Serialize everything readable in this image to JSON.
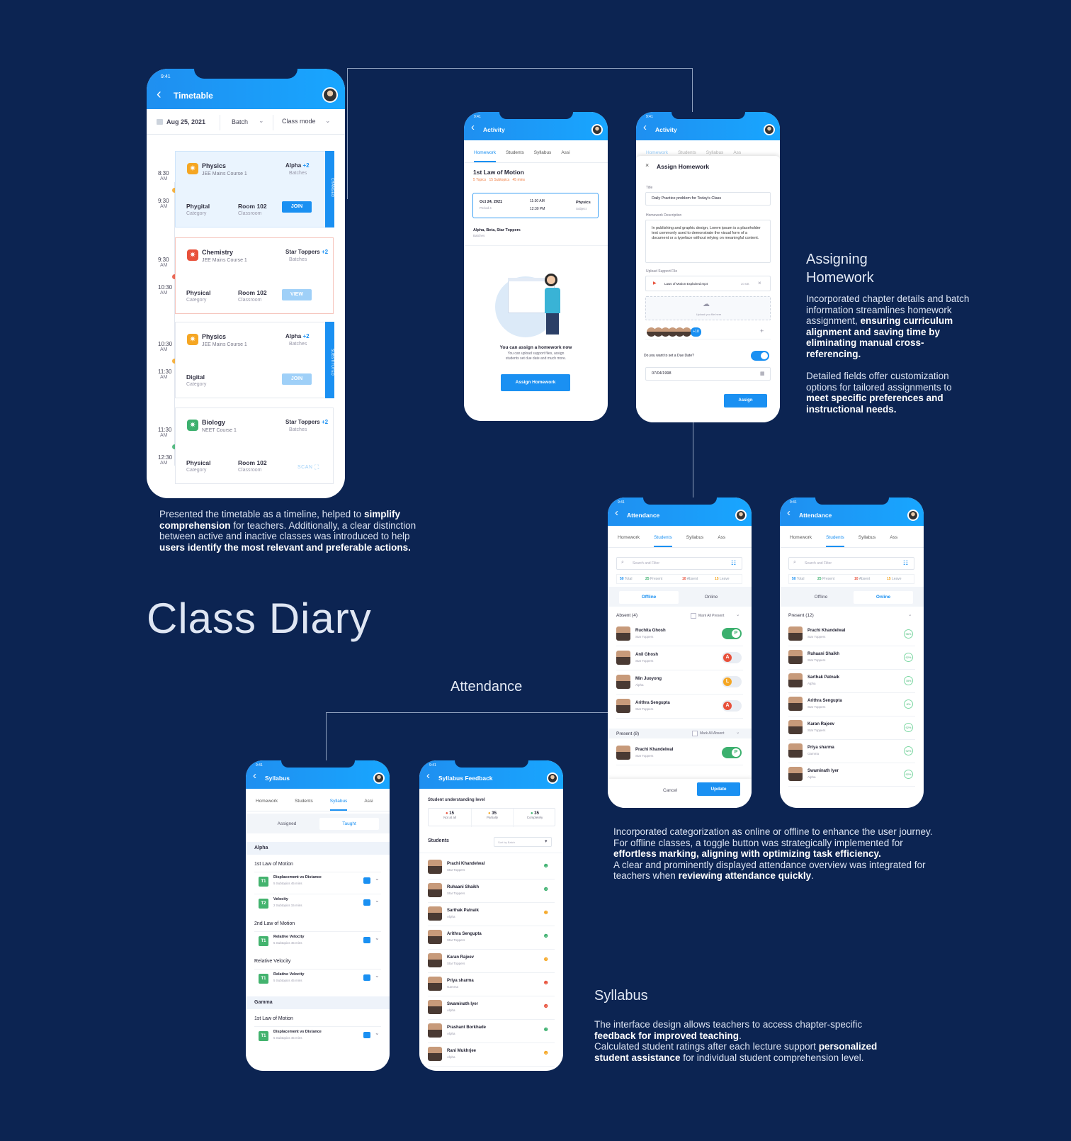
{
  "main_title": "Class Diary",
  "timetable": {
    "time": "9:41",
    "title": "Timetable",
    "date": "Aug 25, 2021",
    "batch": "Batch",
    "class_mode": "Class mode",
    "classes": [
      {
        "start": "8:30",
        "start_ampm": "AM",
        "end": "9:30",
        "end_ampm": "AM",
        "subject": "Physics",
        "course": "JEE Mains Course 1",
        "batch": "Alpha",
        "more": "+2",
        "batch_label": "Batches",
        "mode": "Phygital",
        "mode_label": "Category",
        "room": "Room 102",
        "room_label": "Classroom",
        "action": "JOIN",
        "tag": "CHANGED"
      },
      {
        "start": "9:30",
        "start_ampm": "AM",
        "end": "10:30",
        "end_ampm": "AM",
        "subject": "Chemistry",
        "course": "JEE Mains Course 1",
        "batch": "Star Toppers",
        "more": "+2",
        "batch_label": "Batches",
        "mode": "Physical",
        "mode_label": "Category",
        "room": "Room 102",
        "room_label": "Classroom",
        "action": "VIEW"
      },
      {
        "start": "10:30",
        "start_ampm": "AM",
        "end": "11:30",
        "end_ampm": "AM",
        "subject": "Physics",
        "course": "JEE Mains Course 1",
        "batch": "Alpha",
        "more": "+2",
        "batch_label": "Batches",
        "mode": "Digital",
        "mode_label": "Category",
        "action": "JOIN",
        "tag": "SUBSTITUTED"
      },
      {
        "start": "11:30",
        "start_ampm": "AM",
        "end": "12:30",
        "end_ampm": "AM",
        "subject": "Biology",
        "course": "NEET Course 1",
        "batch": "Star Toppers",
        "more": "+2",
        "batch_label": "Batches",
        "mode": "Physical",
        "mode_label": "Category",
        "room": "Room 102",
        "room_label": "Classroom",
        "action": "SCAN"
      }
    ]
  },
  "timetable_desc": {
    "p1": "Presented the timetable as a timeline, helped to ",
    "b1": "simplify comprehension",
    "p2": " for teachers. Additionally, a clear distinction between active and inactive classes was introduced to help users identify the most relevant and preferable actions.",
    "b2": "users identify the most relevant and preferable actions."
  },
  "activity": {
    "time": "9:41",
    "title": "Activity",
    "tabs": [
      "Homework",
      "Students",
      "Syllabus",
      "Assi"
    ],
    "chapter": "1st Law of Motion",
    "topics": "5 Topics",
    "subtopics": "15 Subtopics",
    "mins": "45 mins",
    "date": "Oct 24, 2021",
    "period": "Period 4",
    "time_start": "11:30 AM",
    "time_end": "12:30 PM",
    "subject": "Physics",
    "subject_label": "Subject",
    "batches": "Alpha, Beta, Star Toppers",
    "batches_label": "Batches",
    "empty_title": "You can assign a homework now",
    "empty_desc1": "You can upload support files, assign",
    "empty_desc2": "students set due date and much more.",
    "cta": "Assign Homework"
  },
  "assign": {
    "time": "9:41",
    "title": "Activity",
    "tabs": [
      "Homework",
      "Students",
      "Syllabus",
      "Ass"
    ],
    "sheet_title": "Assign Homework",
    "title_label": "Title",
    "title_value": "Daily Practice problem for Today's Class",
    "desc_label": "Homework Description",
    "desc_value": "In publishing and graphic design, Lorem ipsum is a placeholder text commonly used to demonstrate the visual form of a document or a typeface without relying on meaningful content.",
    "upload_label": "Upload Support File",
    "file_name": "Laws of Motion Explained.mp4",
    "file_size": "20 MB",
    "upload_hint": "Upload you file here",
    "more_students": "+18",
    "due_question": "Do you want to set a Due Date?",
    "due_date": "07/04/1998",
    "cta": "Assign"
  },
  "homework_section": {
    "heading1": "Assigning",
    "heading2": "Homework",
    "p1a": "Incorporated chapter details and batch information streamlines homework assignment, ",
    "p1b": "ensuring curriculum alignment and saving time by eliminating manual cross-referencing.",
    "p2a": "Detailed fields offer customization options for tailored assignments to ",
    "p2b": "meet specific preferences and instructional needs."
  },
  "attendance_heading": "Attendance",
  "att_offline": {
    "time": "9:41",
    "title": "Attendance",
    "tabs": [
      "Homework",
      "Students",
      "Syllabus",
      "Ass"
    ],
    "search": "Search and Filter",
    "stats": [
      {
        "n": "50",
        "l": "Total"
      },
      {
        "n": "25",
        "l": "Present"
      },
      {
        "n": "10",
        "l": "Absent"
      },
      {
        "n": "15",
        "l": "Leave"
      }
    ],
    "mode_a": "Offline",
    "mode_b": "Online",
    "absent_label": "Absent (4)",
    "mark_present": "Mark All Present",
    "present_label": "Present (8)",
    "mark_absent": "Mark All Absent",
    "absent": [
      {
        "name": "Ruchita Ghosh",
        "batch": "Star Toppers",
        "s": "P"
      },
      {
        "name": "Anil Ghosh",
        "batch": "Star Toppers",
        "s": "A"
      },
      {
        "name": "Min Juoyong",
        "batch": "Alpha",
        "s": "L"
      },
      {
        "name": "Arithra Sengupta",
        "batch": "Star Toppers",
        "s": "A"
      }
    ],
    "present": [
      {
        "name": "Prachi Khandelwal",
        "batch": "Star Toppers",
        "s": "P"
      }
    ],
    "cancel": "Cancel",
    "update": "Update"
  },
  "att_online": {
    "time": "9:41",
    "title": "Attendance",
    "tabs": [
      "Homework",
      "Students",
      "Syllabus",
      "Ass"
    ],
    "search": "Search and Filter",
    "stats": [
      {
        "n": "50",
        "l": "Total"
      },
      {
        "n": "25",
        "l": "Present"
      },
      {
        "n": "10",
        "l": "Absent"
      },
      {
        "n": "15",
        "l": "Leave"
      }
    ],
    "mode_a": "Offline",
    "mode_b": "Online",
    "present_label": "Present (12)",
    "students": [
      {
        "name": "Prachi Khandelwal",
        "batch": "Star Toppers",
        "p": "96%"
      },
      {
        "name": "Ruhaani Shaikh",
        "batch": "Star Toppers",
        "p": "92%"
      },
      {
        "name": "Sarthak Patnaik",
        "batch": "Alpha",
        "p": "78%"
      },
      {
        "name": "Arithra Sengupta",
        "batch": "Star Toppers",
        "p": "8%"
      },
      {
        "name": "Karan Rajeev",
        "batch": "Star Toppers",
        "p": "92%"
      },
      {
        "name": "Priya sharma",
        "batch": "Gamma",
        "p": "92%"
      },
      {
        "name": "Swaminath Iyer",
        "batch": "Alpha",
        "p": "92%"
      }
    ]
  },
  "attendance_desc": {
    "p1": "Incorporated categorization as online or offline to enhance the user journey. For offline classes, a toggle button was strategically implemented for ",
    "b1": "effortless marking, aligning with optimizing task efficiency.",
    "p2": "A clear and prominently displayed attendance overview was integrated for teachers when ",
    "b2": "reviewing attendance quickly",
    "p3": "."
  },
  "syllabus": {
    "time": "9:41",
    "title": "Syllabus",
    "tabs": [
      "Homework",
      "Students",
      "Syllabus",
      "Assi"
    ],
    "seg_a": "Assigned",
    "seg_b": "Taught",
    "groups": [
      {
        "section": "Alpha",
        "chapters": [
          {
            "name": "1st Law of Motion",
            "topics": [
              {
                "t": "T1",
                "name": "Displacement vs Distance",
                "sub": "5 Subtopics",
                "mins": "45 mins"
              },
              {
                "t": "T2",
                "name": "Velocity",
                "sub": "2 Subtopics",
                "mins": "15 mins"
              }
            ]
          },
          {
            "name": "2nd Law of Motion",
            "topics": [
              {
                "t": "T1",
                "name": "Relative Velocity",
                "sub": "5 Subtopics",
                "mins": "45 mins"
              }
            ]
          },
          {
            "name": "Relative Velocity",
            "topics": [
              {
                "t": "T1",
                "name": "Relative Velocity",
                "sub": "5 Subtopics",
                "mins": "45 mins"
              }
            ]
          }
        ]
      },
      {
        "section": "Gamma",
        "chapters": [
          {
            "name": "1st Law of Motion",
            "topics": [
              {
                "t": "T1",
                "name": "Displacement vs Distance",
                "sub": "5 Subtopics",
                "mins": "45 mins"
              }
            ]
          }
        ]
      }
    ]
  },
  "feedback": {
    "time": "9:41",
    "title": "Syllabus Feedback",
    "level_label": "Student understanding level",
    "levels": [
      {
        "n": "15",
        "l": "Not at all"
      },
      {
        "n": "35",
        "l": "Partially"
      },
      {
        "n": "35",
        "l": "Completely"
      }
    ],
    "students_label": "Students",
    "sort": "Sort by Batch",
    "students": [
      {
        "name": "Prachi Khandelwal",
        "batch": "Star Toppers",
        "c": "#3cb06e"
      },
      {
        "name": "Ruhaani Shaikh",
        "batch": "Star Toppers",
        "c": "#3cb06e"
      },
      {
        "name": "Sarthak Patnaik",
        "batch": "Alpha",
        "c": "#f5a623"
      },
      {
        "name": "Arithra Sengupta",
        "batch": "Star Toppers",
        "c": "#3cb06e"
      },
      {
        "name": "Karan Rajeev",
        "batch": "Star Toppers",
        "c": "#f5a623"
      },
      {
        "name": "Priya sharma",
        "batch": "Gamma",
        "c": "#e8503a"
      },
      {
        "name": "Swaminath Iyer",
        "batch": "Alpha",
        "c": "#e8503a"
      },
      {
        "name": "Prashant Borkhade",
        "batch": "Alpha",
        "c": "#3cb06e"
      },
      {
        "name": "Rani Mukhrjee",
        "batch": "Alpha",
        "c": "#f5a623"
      }
    ]
  },
  "syllabus_section": {
    "heading": "Syllabus",
    "p1a": "The interface design allows teachers to access chapter-specific ",
    "p1b": "feedback for improved teaching",
    "p1c": ".",
    "p2a": "Calculated student ratings after each lecture support ",
    "p2b": "personalized student assistance",
    "p2c": " for individual student comprehension level."
  },
  "colors": {
    "background": "#0c2452",
    "accent": "#1a90f2",
    "success": "#3cb06e",
    "danger": "#e8503a",
    "warning": "#f5a623"
  }
}
